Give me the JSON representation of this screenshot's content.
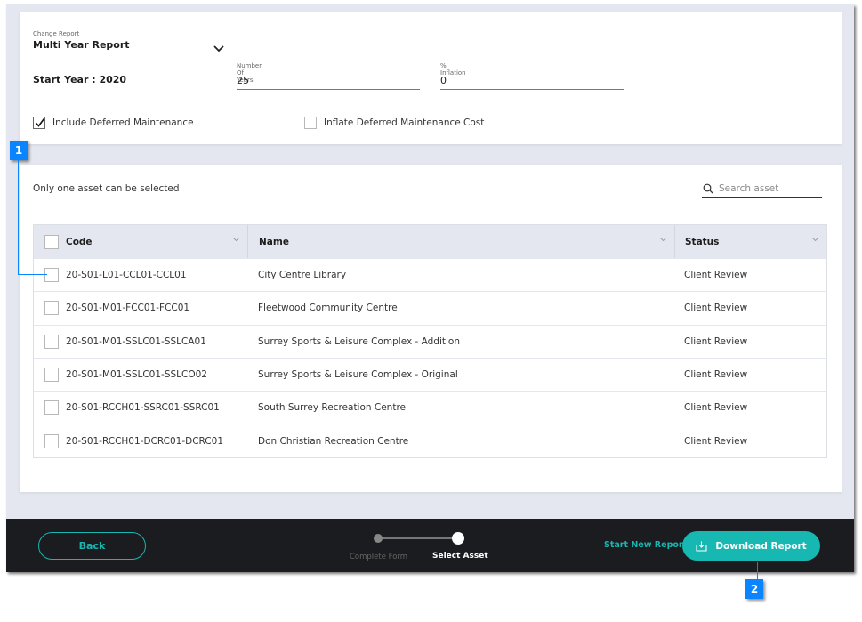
{
  "report": {
    "change_label": "Change Report",
    "selected": "Multi Year Report",
    "start_year_text": "Start Year : 2020",
    "num_years_label": "Number Of Years",
    "num_years_value": "25",
    "inflation_label": "% Inflation",
    "inflation_value": "0",
    "include_deferred_label": "Include Deferred Maintenance",
    "include_deferred_checked": true,
    "inflate_deferred_label": "Inflate Deferred Maintenance Cost",
    "inflate_deferred_checked": false
  },
  "assets": {
    "hint": "Only one asset can be selected",
    "search_placeholder": "Search asset",
    "columns": [
      "Code",
      "Name",
      "Status"
    ],
    "rows": [
      {
        "code": "20-S01-L01-CCL01-CCL01",
        "name": "City Centre Library",
        "status": "Client Review"
      },
      {
        "code": "20-S01-M01-FCC01-FCC01",
        "name": "Fleetwood Community Centre",
        "status": "Client Review"
      },
      {
        "code": "20-S01-M01-SSLC01-SSLCA01",
        "name": "Surrey Sports & Leisure Complex - Addition",
        "status": "Client Review"
      },
      {
        "code": "20-S01-M01-SSLC01-SSLCO02",
        "name": "Surrey Sports & Leisure Complex - Original",
        "status": "Client Review"
      },
      {
        "code": "20-S01-RCCH01-SSRC01-SSRC01",
        "name": "South Surrey Recreation Centre",
        "status": "Client Review"
      },
      {
        "code": "20-S01-RCCH01-DCRC01-DCRC01",
        "name": "Don Christian Recreation Centre",
        "status": "Client Review"
      }
    ]
  },
  "footer": {
    "back_label": "Back",
    "steps": [
      "Complete Form",
      "Select Asset"
    ],
    "active_step": "Select Asset",
    "start_new_label": "Start New Report",
    "download_label": "Download Report"
  },
  "callouts": [
    "1",
    "2"
  ],
  "colors": {
    "accent": "#17b7b2",
    "callout": "#0a84ff",
    "footer_bg": "#1b1c1f",
    "page_bg": "#e4e7ef"
  }
}
